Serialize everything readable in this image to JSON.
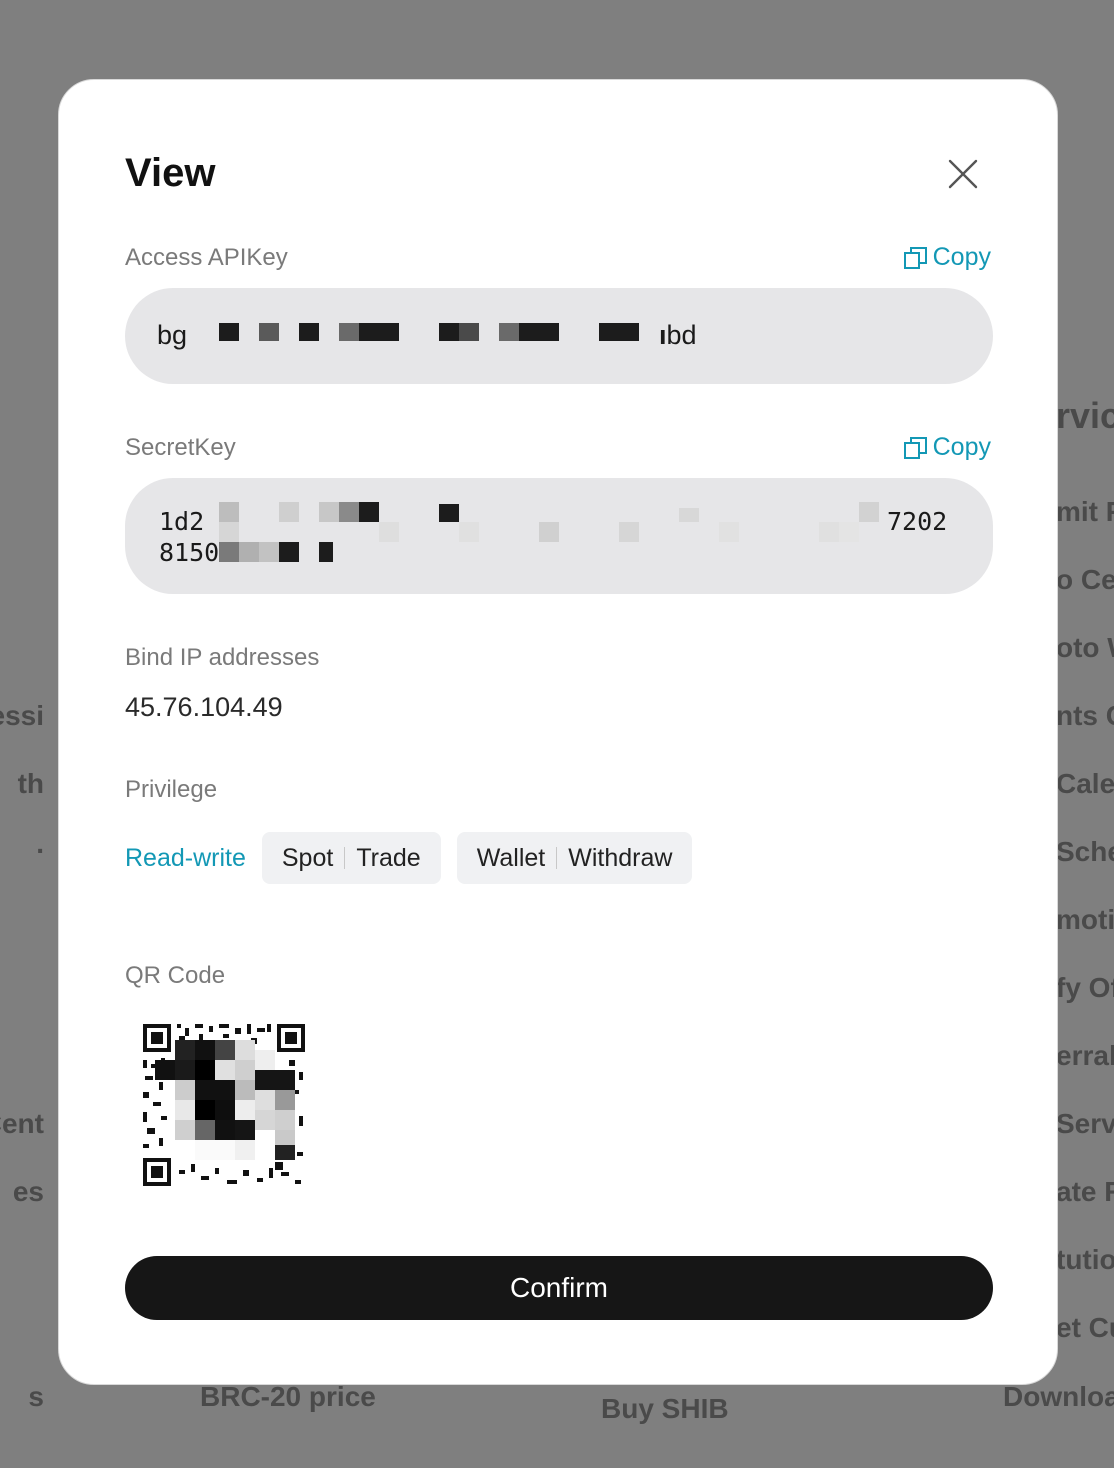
{
  "background": {
    "left_items": [
      "essi",
      "th",
      ".",
      "Cent",
      "es",
      "s"
    ],
    "right_items": [
      "rvice",
      "mit F",
      "o Cen",
      "oto W",
      "nts C",
      "Cale",
      "Sche",
      "motio",
      "fy Of",
      "erral I",
      "Servi",
      "ate R",
      "tutio",
      "et Cu",
      "Downloa"
    ],
    "bottom_items": [
      "BRC-20 price",
      "Buy SHIB"
    ]
  },
  "modal": {
    "title": "View",
    "access_key": {
      "label": "Access APIKey",
      "copy_label": "Copy",
      "value_start": "bg",
      "value_end": "bd"
    },
    "secret_key": {
      "label": "SecretKey",
      "copy_label": "Copy",
      "line1_start": "1d2",
      "line1_end": "7202",
      "line2_start": "8150"
    },
    "bind_ip": {
      "label": "Bind IP addresses",
      "value": "45.76.104.49"
    },
    "privilege": {
      "label": "Privilege",
      "level": "Read-write",
      "chips": [
        {
          "left": "Spot",
          "right": "Trade"
        },
        {
          "left": "Wallet",
          "right": "Withdraw"
        }
      ]
    },
    "qr": {
      "label": "QR Code"
    },
    "confirm_label": "Confirm"
  },
  "colors": {
    "accent": "#1398b5",
    "overlay": "#7f7f7f",
    "confirm_bg": "#161616"
  }
}
